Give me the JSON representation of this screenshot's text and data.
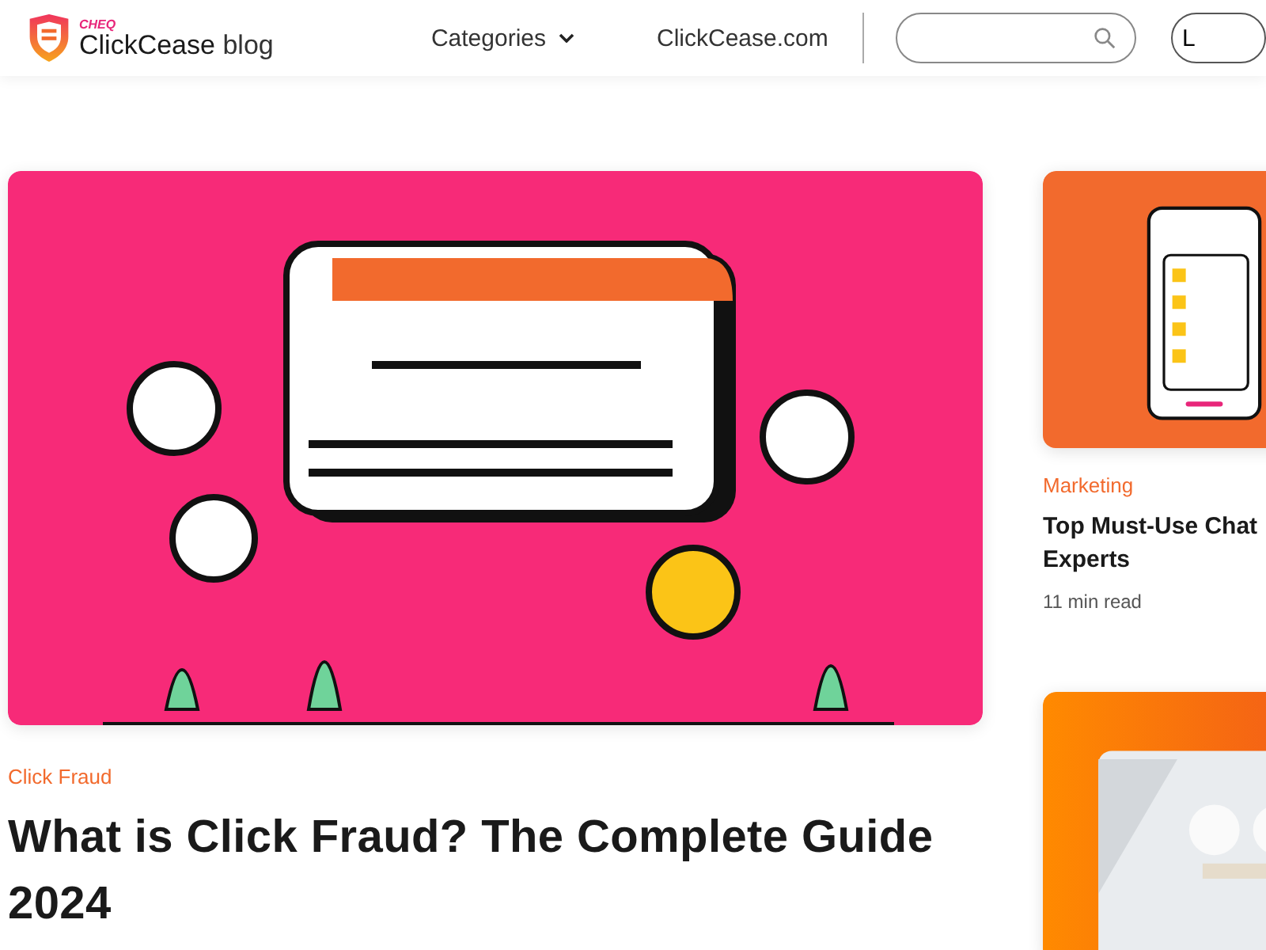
{
  "header": {
    "logo": {
      "badge": "CHEQ",
      "name": "ClickCease",
      "suffix": "blog"
    },
    "nav": [
      {
        "label": "Categories",
        "kind": "dropdown"
      },
      {
        "label": "ClickCease.com",
        "kind": "link"
      }
    ],
    "button": {
      "label": "L"
    }
  },
  "featured": {
    "image": {
      "kind": "picture"
    },
    "category": "Click Fraud",
    "title": "What is Click Fraud? The Complete Guide 2024"
  },
  "side_posts": [
    {
      "image": {
        "kind": "picture"
      },
      "category": "Marketing",
      "title_lines": [
        "Top Must-Use Chat",
        "Experts"
      ],
      "read_time": "11 min read"
    },
    {
      "image": {
        "kind": "picture"
      }
    }
  ]
}
